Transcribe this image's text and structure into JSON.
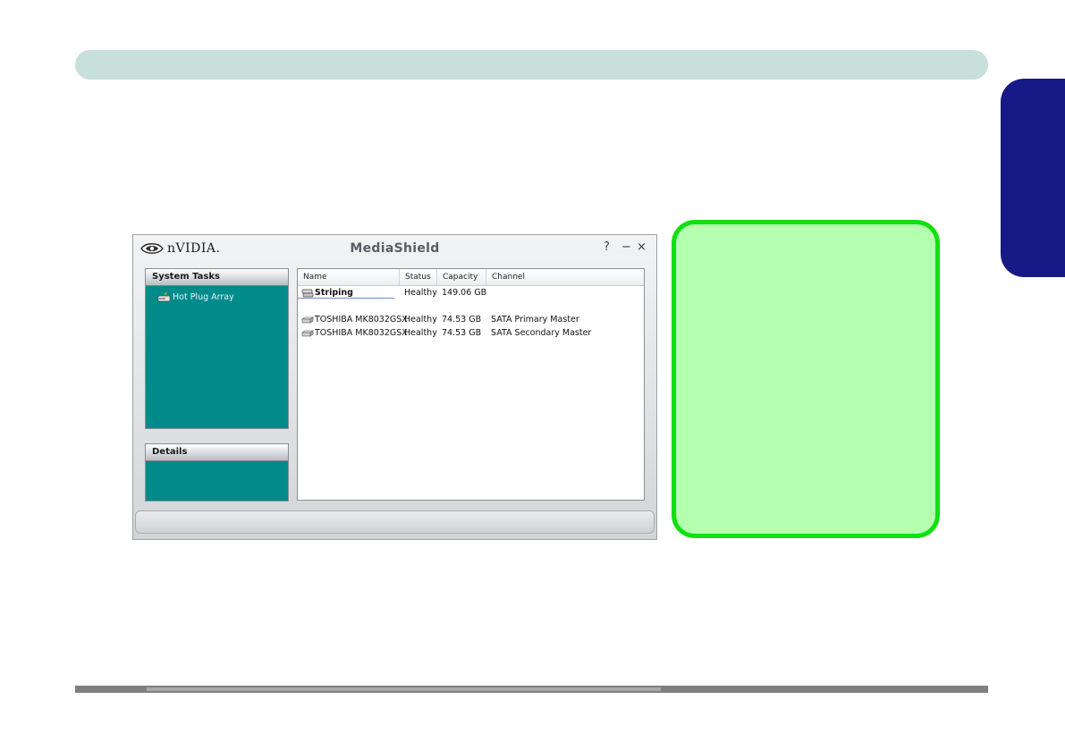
{
  "app": {
    "brand": "nVIDIA.",
    "title": "MediaShield",
    "help_glyph": "?",
    "minimize_glyph": "−",
    "close_glyph": "×"
  },
  "system_tasks": {
    "heading": "System Tasks",
    "items": [
      {
        "label": "Hot Plug Array",
        "icon": "hot-plug-icon"
      }
    ]
  },
  "details": {
    "heading": "Details"
  },
  "list": {
    "columns": [
      "Name",
      "Status",
      "Capacity",
      "Channel"
    ],
    "rows": [
      {
        "name": "Striping",
        "status": "Healthy",
        "capacity": "149.06 GB",
        "channel": "",
        "icon": "array-disk-icon"
      },
      {
        "name": "TOSHIBA MK8032GSX",
        "status": "Healthy",
        "capacity": "74.53 GB",
        "channel": "SATA Primary Master",
        "icon": "disk-icon"
      },
      {
        "name": "TOSHIBA MK8032GSX",
        "status": "Healthy",
        "capacity": "74.53 GB",
        "channel": "SATA Secondary Master",
        "icon": "disk-icon"
      }
    ]
  },
  "colors": {
    "header_bar": "#c8e0dc",
    "side_tab": "#171a86",
    "note_fill": "#b5ffb0",
    "note_border": "#10e010",
    "panel_teal": "#008b8b"
  }
}
